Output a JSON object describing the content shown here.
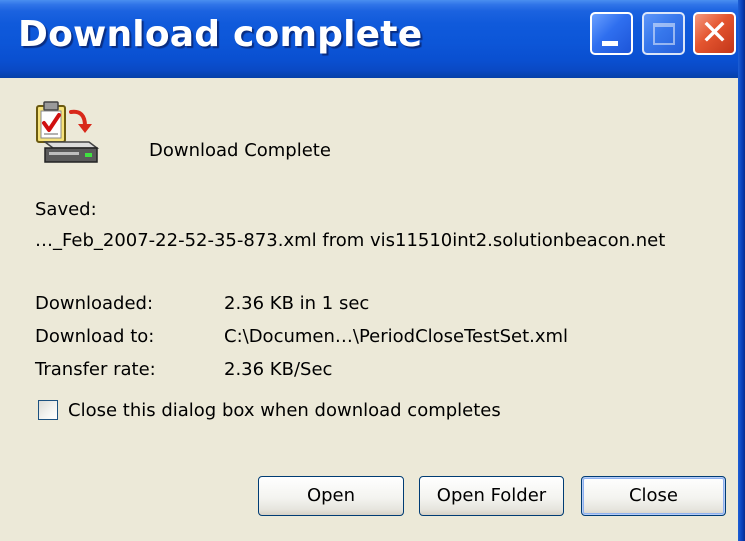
{
  "window": {
    "title": "Download complete",
    "controls": [
      "minimize-icon",
      "maximize-icon",
      "close-icon"
    ]
  },
  "dialog": {
    "icon": "download-complete-icon",
    "headline": "Download Complete",
    "saved_label": "Saved:",
    "saved_value": "…_Feb_2007-22-52-35-873.xml from vis11510int2.solutionbeacon.net",
    "details": [
      {
        "label": "Downloaded:",
        "value": "2.36 KB in 1 sec"
      },
      {
        "label": "Download to:",
        "value": "C:\\Documen…\\PeriodCloseTestSet.xml"
      },
      {
        "label": "Transfer rate:",
        "value": "2.36 KB/Sec"
      }
    ],
    "checkbox": {
      "label": "Close this dialog box when download completes",
      "checked": false
    },
    "buttons": {
      "open": "Open",
      "open_folder": "Open Folder",
      "close": "Close"
    }
  },
  "colors": {
    "titlebar": "#0c56d8",
    "dialog_background": "#ece9d8",
    "close_button": "#e4552f"
  }
}
